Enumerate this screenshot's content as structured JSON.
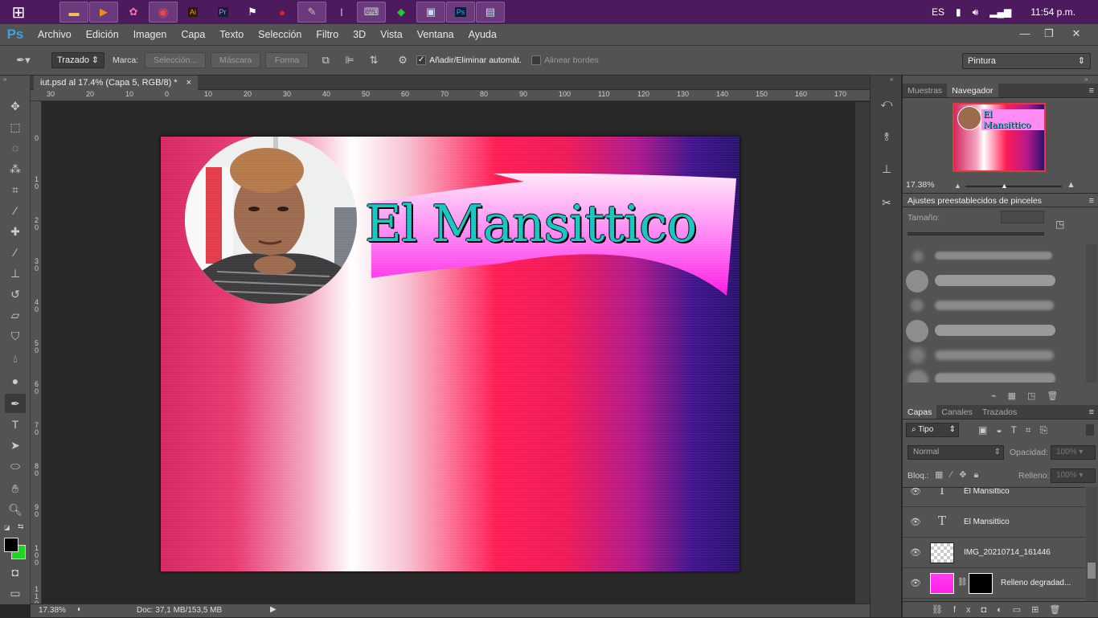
{
  "taskbar": {
    "apps": [
      "file-explorer",
      "media-player",
      "paint",
      "chrome",
      "illustrator",
      "premiere",
      "inkscape",
      "media",
      "photo-editor",
      "tool",
      "on-screen-keyboard",
      "app",
      "window",
      "photoshop",
      "notepad"
    ],
    "language": "ES",
    "clock": "11:54 p.m."
  },
  "app": {
    "logo": "Ps",
    "menu": [
      "Archivo",
      "Edición",
      "Imagen",
      "Capa",
      "Texto",
      "Selección",
      "Filtro",
      "3D",
      "Vista",
      "Ventana",
      "Ayuda"
    ],
    "window_controls": [
      "—",
      "❐",
      "✕"
    ]
  },
  "options": {
    "mode": "Trazado",
    "marca_label": "Marca:",
    "seleccion": "Selección...",
    "mascara": "Máscara",
    "forma": "Forma",
    "add_delete": "Añadir/Eliminar automát.",
    "align_edges": "Alinear bordes",
    "workspace": "Pintura"
  },
  "document": {
    "tab_title": "iut.psd al 17.4% (Capa 5, RGB/8) *",
    "close": "×",
    "canvas_title": "El Mansittico"
  },
  "rulers": {
    "h": [
      "30",
      "20",
      "10",
      "0",
      "10",
      "20",
      "30",
      "40",
      "50",
      "60",
      "70",
      "80",
      "90",
      "100",
      "110",
      "120",
      "130",
      "140",
      "150",
      "160",
      "170"
    ],
    "v": [
      "0",
      "1 0",
      "2 0",
      "3 0",
      "4 0",
      "5 0",
      "6 0",
      "7 0",
      "8 0",
      "9 0",
      "1 0 0",
      "1 1 0"
    ]
  },
  "status": {
    "zoom": "17.38%",
    "doc": "Doc: 37,1 MB/153,5 MB"
  },
  "navigator": {
    "tabs": [
      "Muestras",
      "Navegador"
    ],
    "zoom": "17.38%",
    "thumb_title": "El Mansittico"
  },
  "brushes": {
    "title": "Ajustes preestablecidos de pinceles",
    "size_label": "Tamaño:"
  },
  "layers": {
    "tabs": [
      "Capas",
      "Canales",
      "Trazados"
    ],
    "filter": "Tipo",
    "blend": "Normal",
    "opacity_label": "Opacidad:",
    "opacity_value": "100%",
    "lock_label": "Bloq.:",
    "fill_label": "Relleno:",
    "fill_value": "100%",
    "items": [
      {
        "name": "El Mansittico",
        "kind": "text"
      },
      {
        "name": "El Mansittico",
        "kind": "text"
      },
      {
        "name": "IMG_20210714_161446",
        "kind": "image"
      },
      {
        "name": "Relleno degradad...",
        "kind": "gradient"
      }
    ]
  }
}
